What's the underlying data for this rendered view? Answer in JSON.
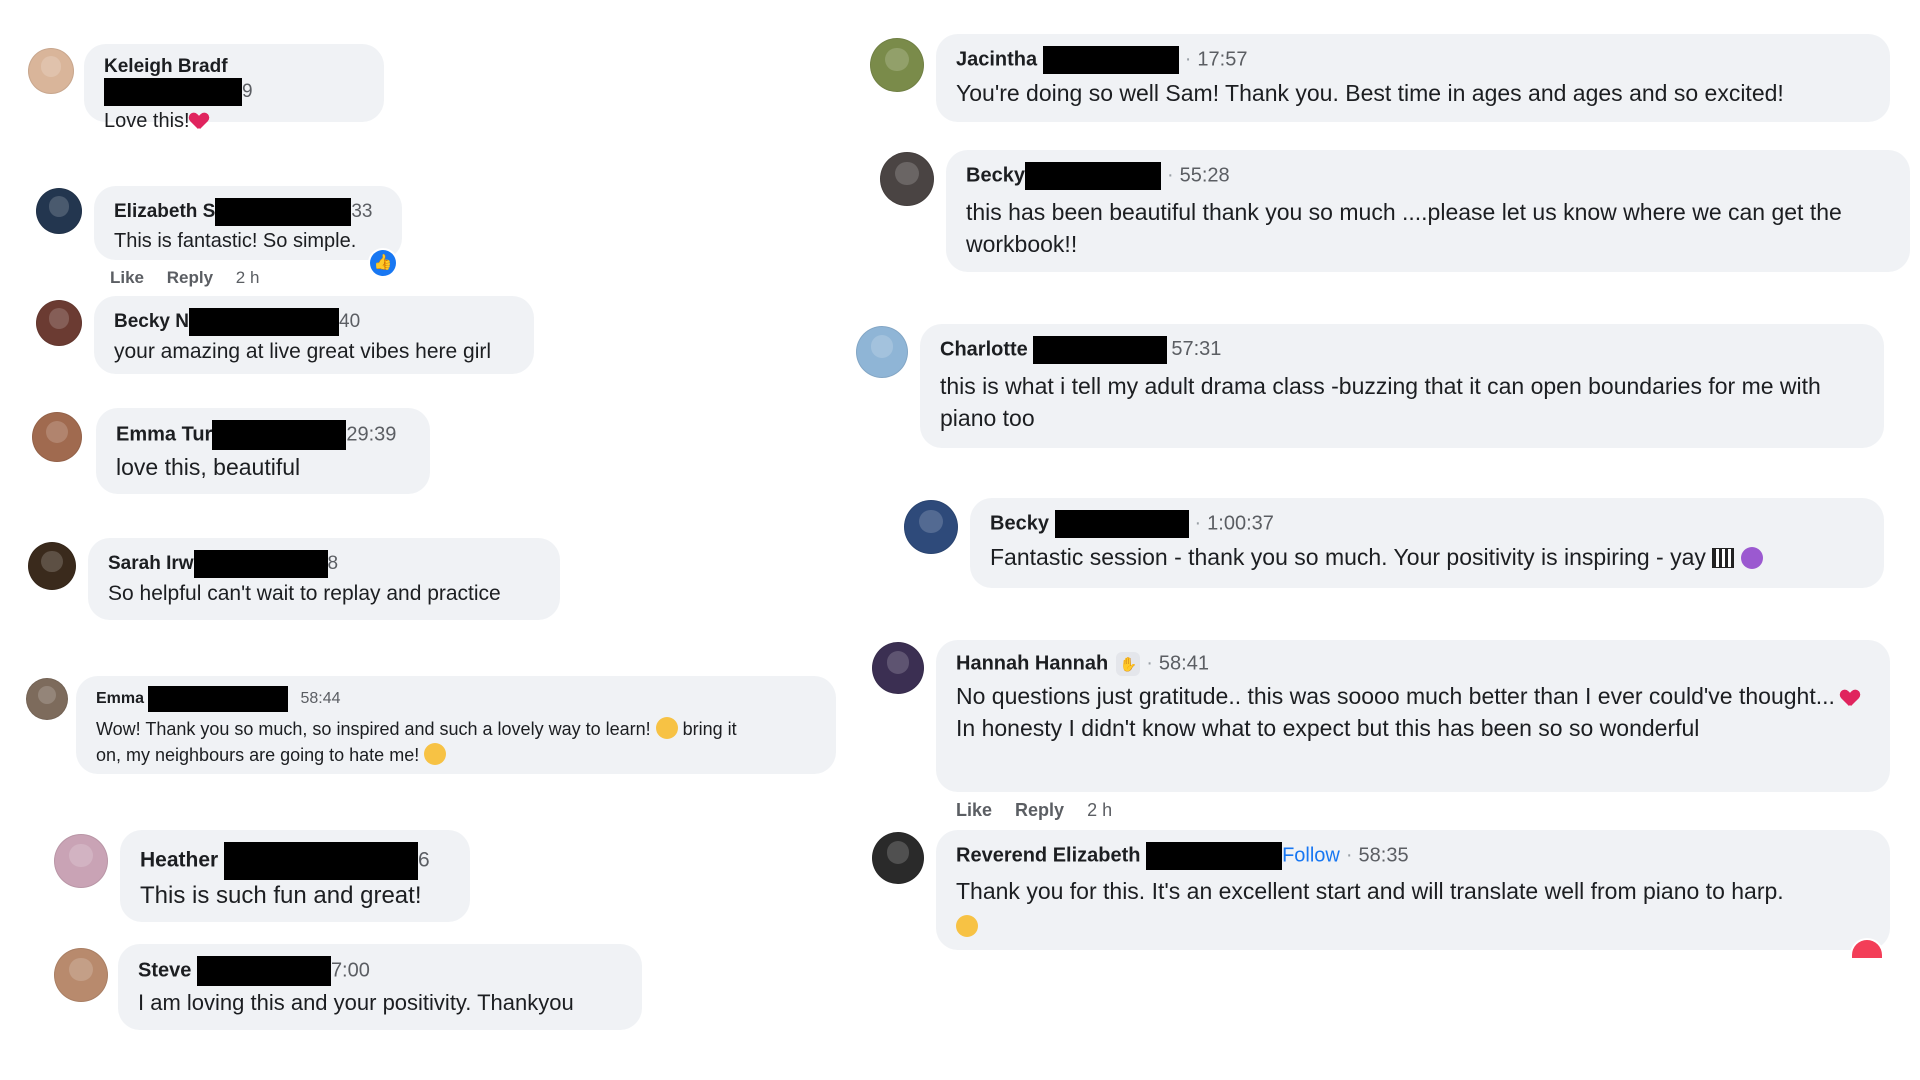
{
  "comments_left": [
    {
      "name": "Keleigh Bradf",
      "time_suffix": "9",
      "text": "Love this!",
      "emoji": "heart-icon"
    },
    {
      "name": "Elizabeth S",
      "time_suffix": "33",
      "text": "This is fantastic! So simple.",
      "actions": {
        "like": "Like",
        "reply": "Reply",
        "age": "2 h"
      },
      "reaction": "like-icon"
    },
    {
      "name": "Becky N",
      "time_suffix": "40",
      "text": "your amazing at live great vibes here girl"
    },
    {
      "name": "Emma Tur",
      "time_suffix": "29:39",
      "text": "love this, beautiful"
    },
    {
      "name": "Sarah Irw",
      "time_suffix": "8",
      "text": "So helpful can't wait to replay and practice"
    },
    {
      "name": "Emma",
      "time": "58:44",
      "text_1": "Wow! Thank you so much, so inspired and such a lovely way to learn!",
      "text_2": "bring it",
      "text_3": "on, my neighbours are going to hate me!"
    },
    {
      "name": "Heather",
      "time_suffix": "6",
      "text": "This is such fun and great!"
    },
    {
      "name": "Steve",
      "time_suffix": "7:00",
      "text": "I am loving this and your positivity. Thankyou"
    }
  ],
  "comments_right": [
    {
      "name": "Jacintha",
      "time": "17:57",
      "text": "You're doing so well Sam! Thank you. Best time in ages and ages and so excited!"
    },
    {
      "name": "Becky",
      "time": "55:28",
      "text": "this has been beautiful thank you so much ....please let us know where we can get the workbook!!"
    },
    {
      "name": "Charlotte",
      "time": "57:31",
      "text": "this is what i tell my adult drama class -buzzing that it can open boundaries for me with piano too"
    },
    {
      "name": "Becky",
      "time": "1:00:37",
      "text": "Fantastic session - thank you so much. Your positivity is inspiring - yay"
    },
    {
      "name": "Hannah Hannah",
      "time": "58:41",
      "text_1": "No questions just gratitude.. this was soooo much better than I ever could've thought...",
      "text_2": "In honesty I didn't know what to expect but this has been so so wonderful",
      "actions": {
        "like": "Like",
        "reply": "Reply",
        "age": "2 h"
      }
    },
    {
      "name": "Reverend Elizabeth",
      "follow": "Follow",
      "time": "58:35",
      "text": "Thank you for this. It's an excellent start and will translate well from piano to harp."
    }
  ],
  "dot": "·",
  "colors": {
    "bubble": "#f0f2f5",
    "accent": "#1877f2",
    "heart": "#e0245e"
  }
}
